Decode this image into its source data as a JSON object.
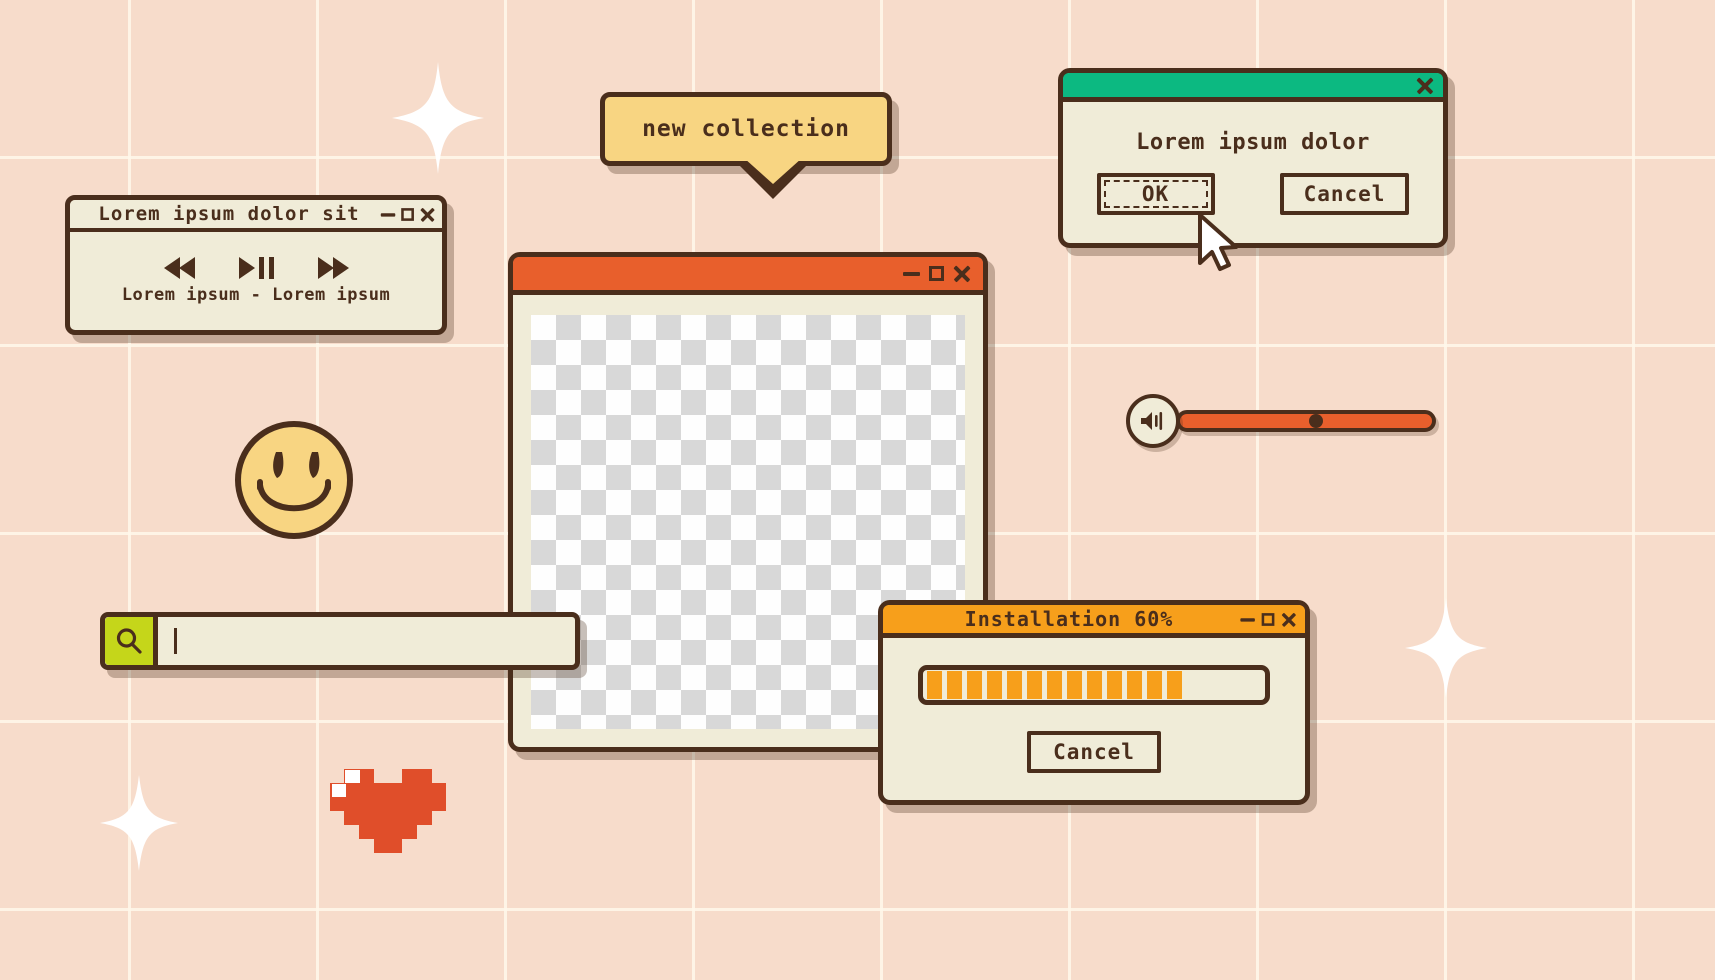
{
  "theme": {
    "background": "#f7dccb",
    "grid_line": "#fff8eb",
    "ink": "#4a2e1c",
    "window_face": "#f0ecd8",
    "accent_orange": "#e85f2c",
    "accent_amber": "#f79f1b",
    "accent_green": "#0cb981",
    "accent_yellow": "#f8d582",
    "accent_lime": "#c5d61a"
  },
  "player_window": {
    "title": "Lorem ipsum dolor sit",
    "controls": [
      "minimize",
      "maximize",
      "close"
    ],
    "transport": {
      "previous": "rewind-icon",
      "playpause": "play-pause-icon",
      "next": "fast-forward-icon"
    },
    "track_label": "Lorem ipsum - Lorem ipsum"
  },
  "speech_bubble": {
    "text": "new collection"
  },
  "dialog_window": {
    "title": "",
    "close_label": "close-icon",
    "message": "Lorem ipsum dolor",
    "ok_label": "OK",
    "cancel_label": "Cancel",
    "cursor": "arrow-cursor"
  },
  "main_window": {
    "title": "",
    "controls": [
      "minimize",
      "maximize",
      "close"
    ],
    "content": "transparent-checkerboard-placeholder"
  },
  "install_window": {
    "title": "Installation 60%",
    "progress_percent": 60,
    "progress_segments_total": 22,
    "progress_segments_filled": 13,
    "controls": [
      "minimize",
      "maximize",
      "close"
    ],
    "cancel_label": "Cancel"
  },
  "search_bar": {
    "icon": "magnifier-icon",
    "value": "",
    "placeholder": ""
  },
  "volume_control": {
    "icon": "speaker-volume-icon",
    "value_percent": 54
  },
  "decorations": {
    "smiley": "smiley-face",
    "heart": "pixel-heart",
    "sparkles": 3
  }
}
